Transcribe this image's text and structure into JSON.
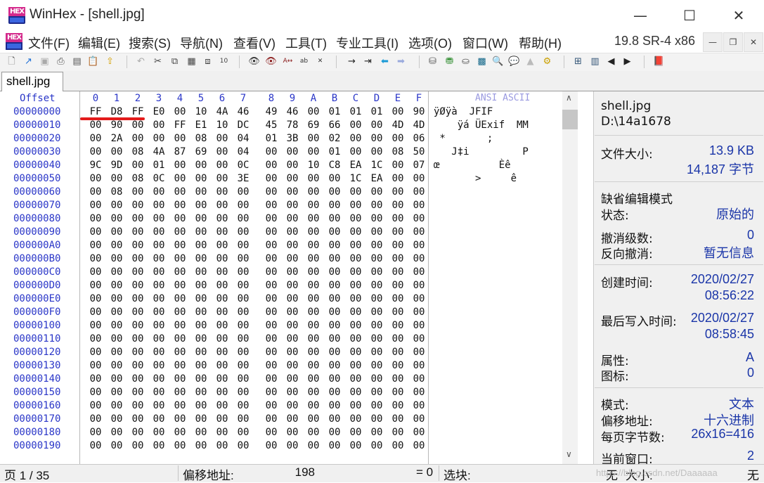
{
  "window": {
    "title": "WinHex - [shell.jpg]",
    "logo_text": "HEX",
    "minimize": "—",
    "maximize": "☐",
    "close": "✕"
  },
  "menu": {
    "items": [
      "文件(F)",
      "编辑(E)",
      "搜索(S)",
      "导航(N)",
      "查看(V)",
      "工具(T)",
      "专业工具(I)",
      "选项(O)",
      "窗口(W)",
      "帮助(H)"
    ],
    "version": "19.8 SR-4 x86",
    "mdi_minimize": "—",
    "mdi_restore": "❐",
    "mdi_close": "✕"
  },
  "tab": {
    "label": "shell.jpg"
  },
  "hex": {
    "offset_header": "Offset",
    "columns": [
      "0",
      "1",
      "2",
      "3",
      "4",
      "5",
      "6",
      "7",
      "8",
      "9",
      "A",
      "B",
      "C",
      "D",
      "E",
      "F"
    ],
    "ansi_header": "ANSI ASCII",
    "rows": [
      {
        "offset": "00000000",
        "bytes": [
          "FF",
          "D8",
          "FF",
          "E0",
          "00",
          "10",
          "4A",
          "46",
          "49",
          "46",
          "00",
          "01",
          "01",
          "01",
          "00",
          "90"
        ],
        "ansi": "ÿØÿà  JFIF"
      },
      {
        "offset": "00000010",
        "bytes": [
          "00",
          "90",
          "00",
          "00",
          "FF",
          "E1",
          "10",
          "DC",
          "45",
          "78",
          "69",
          "66",
          "00",
          "00",
          "4D",
          "4D"
        ],
        "ansi": "    ÿá ÜExif  MM"
      },
      {
        "offset": "00000020",
        "bytes": [
          "00",
          "2A",
          "00",
          "00",
          "00",
          "08",
          "00",
          "04",
          "01",
          "3B",
          "00",
          "02",
          "00",
          "00",
          "00",
          "06"
        ],
        "ansi": " *       ;"
      },
      {
        "offset": "00000030",
        "bytes": [
          "00",
          "00",
          "08",
          "4A",
          "87",
          "69",
          "00",
          "04",
          "00",
          "00",
          "00",
          "01",
          "00",
          "00",
          "08",
          "50"
        ],
        "ansi": "   J‡i         P"
      },
      {
        "offset": "00000040",
        "bytes": [
          "9C",
          "9D",
          "00",
          "01",
          "00",
          "00",
          "00",
          "0C",
          "00",
          "00",
          "10",
          "C8",
          "EA",
          "1C",
          "00",
          "07"
        ],
        "ansi": "œ          Èê"
      },
      {
        "offset": "00000050",
        "bytes": [
          "00",
          "00",
          "08",
          "0C",
          "00",
          "00",
          "00",
          "3E",
          "00",
          "00",
          "00",
          "00",
          "1C",
          "EA",
          "00",
          "00"
        ],
        "ansi": "       >     ê"
      },
      {
        "offset": "00000060",
        "bytes": [
          "00",
          "08",
          "00",
          "00",
          "00",
          "00",
          "00",
          "00",
          "00",
          "00",
          "00",
          "00",
          "00",
          "00",
          "00",
          "00"
        ],
        "ansi": ""
      },
      {
        "offset": "00000070",
        "bytes": [
          "00",
          "00",
          "00",
          "00",
          "00",
          "00",
          "00",
          "00",
          "00",
          "00",
          "00",
          "00",
          "00",
          "00",
          "00",
          "00"
        ],
        "ansi": ""
      },
      {
        "offset": "00000080",
        "bytes": [
          "00",
          "00",
          "00",
          "00",
          "00",
          "00",
          "00",
          "00",
          "00",
          "00",
          "00",
          "00",
          "00",
          "00",
          "00",
          "00"
        ],
        "ansi": ""
      },
      {
        "offset": "00000090",
        "bytes": [
          "00",
          "00",
          "00",
          "00",
          "00",
          "00",
          "00",
          "00",
          "00",
          "00",
          "00",
          "00",
          "00",
          "00",
          "00",
          "00"
        ],
        "ansi": ""
      },
      {
        "offset": "000000A0",
        "bytes": [
          "00",
          "00",
          "00",
          "00",
          "00",
          "00",
          "00",
          "00",
          "00",
          "00",
          "00",
          "00",
          "00",
          "00",
          "00",
          "00"
        ],
        "ansi": ""
      },
      {
        "offset": "000000B0",
        "bytes": [
          "00",
          "00",
          "00",
          "00",
          "00",
          "00",
          "00",
          "00",
          "00",
          "00",
          "00",
          "00",
          "00",
          "00",
          "00",
          "00"
        ],
        "ansi": ""
      },
      {
        "offset": "000000C0",
        "bytes": [
          "00",
          "00",
          "00",
          "00",
          "00",
          "00",
          "00",
          "00",
          "00",
          "00",
          "00",
          "00",
          "00",
          "00",
          "00",
          "00"
        ],
        "ansi": ""
      },
      {
        "offset": "000000D0",
        "bytes": [
          "00",
          "00",
          "00",
          "00",
          "00",
          "00",
          "00",
          "00",
          "00",
          "00",
          "00",
          "00",
          "00",
          "00",
          "00",
          "00"
        ],
        "ansi": ""
      },
      {
        "offset": "000000E0",
        "bytes": [
          "00",
          "00",
          "00",
          "00",
          "00",
          "00",
          "00",
          "00",
          "00",
          "00",
          "00",
          "00",
          "00",
          "00",
          "00",
          "00"
        ],
        "ansi": ""
      },
      {
        "offset": "000000F0",
        "bytes": [
          "00",
          "00",
          "00",
          "00",
          "00",
          "00",
          "00",
          "00",
          "00",
          "00",
          "00",
          "00",
          "00",
          "00",
          "00",
          "00"
        ],
        "ansi": ""
      },
      {
        "offset": "00000100",
        "bytes": [
          "00",
          "00",
          "00",
          "00",
          "00",
          "00",
          "00",
          "00",
          "00",
          "00",
          "00",
          "00",
          "00",
          "00",
          "00",
          "00"
        ],
        "ansi": ""
      },
      {
        "offset": "00000110",
        "bytes": [
          "00",
          "00",
          "00",
          "00",
          "00",
          "00",
          "00",
          "00",
          "00",
          "00",
          "00",
          "00",
          "00",
          "00",
          "00",
          "00"
        ],
        "ansi": ""
      },
      {
        "offset": "00000120",
        "bytes": [
          "00",
          "00",
          "00",
          "00",
          "00",
          "00",
          "00",
          "00",
          "00",
          "00",
          "00",
          "00",
          "00",
          "00",
          "00",
          "00"
        ],
        "ansi": ""
      },
      {
        "offset": "00000130",
        "bytes": [
          "00",
          "00",
          "00",
          "00",
          "00",
          "00",
          "00",
          "00",
          "00",
          "00",
          "00",
          "00",
          "00",
          "00",
          "00",
          "00"
        ],
        "ansi": ""
      },
      {
        "offset": "00000140",
        "bytes": [
          "00",
          "00",
          "00",
          "00",
          "00",
          "00",
          "00",
          "00",
          "00",
          "00",
          "00",
          "00",
          "00",
          "00",
          "00",
          "00"
        ],
        "ansi": ""
      },
      {
        "offset": "00000150",
        "bytes": [
          "00",
          "00",
          "00",
          "00",
          "00",
          "00",
          "00",
          "00",
          "00",
          "00",
          "00",
          "00",
          "00",
          "00",
          "00",
          "00"
        ],
        "ansi": ""
      },
      {
        "offset": "00000160",
        "bytes": [
          "00",
          "00",
          "00",
          "00",
          "00",
          "00",
          "00",
          "00",
          "00",
          "00",
          "00",
          "00",
          "00",
          "00",
          "00",
          "00"
        ],
        "ansi": ""
      },
      {
        "offset": "00000170",
        "bytes": [
          "00",
          "00",
          "00",
          "00",
          "00",
          "00",
          "00",
          "00",
          "00",
          "00",
          "00",
          "00",
          "00",
          "00",
          "00",
          "00"
        ],
        "ansi": ""
      },
      {
        "offset": "00000180",
        "bytes": [
          "00",
          "00",
          "00",
          "00",
          "00",
          "00",
          "00",
          "00",
          "00",
          "00",
          "00",
          "00",
          "00",
          "00",
          "00",
          "00"
        ],
        "ansi": ""
      },
      {
        "offset": "00000190",
        "bytes": [
          "00",
          "00",
          "00",
          "00",
          "00",
          "00",
          "00",
          "00",
          "00",
          "00",
          "00",
          "00",
          "00",
          "00",
          "00",
          "00"
        ],
        "ansi": ""
      }
    ]
  },
  "info": {
    "filename": "shell.jpg",
    "path": "D:\\14a1678",
    "filesize_label": "文件大小:",
    "filesize_kb": "13.9 KB",
    "filesize_bytes": "14,187 字节",
    "edit_mode": "缺省编辑模式",
    "state_label": "状态:",
    "state_value": "原始的",
    "undo_label": "撤消级数:",
    "undo_value": "0",
    "redo_label": "反向撤消:",
    "redo_value": "暂无信息",
    "created_label": "创建时间:",
    "created_date": "2020/02/27",
    "created_time": "08:56:22",
    "modified_label": "最后写入时间:",
    "modified_date": "2020/02/27",
    "modified_time": "08:58:45",
    "attr_label": "属性:",
    "attr_value": "A",
    "icon_label": "图标:",
    "icon_value": "0",
    "mode_label": "模式:",
    "mode_value": "文本",
    "offset_label": "偏移地址:",
    "offset_value": "十六进制",
    "bpp_label": "每页字节数:",
    "bpp_value": "26x16=416",
    "window_label": "当前窗口:",
    "window_value": "2"
  },
  "status": {
    "page": "页 1 / 35",
    "offset_label": "偏移地址:",
    "offset_value": "198",
    "eq": "= 0",
    "block_label": "选块:",
    "none1": "无",
    "size_label": "大小:",
    "none2": "无",
    "watermark": "https://blog.csdn.net/Daaaaaa"
  }
}
